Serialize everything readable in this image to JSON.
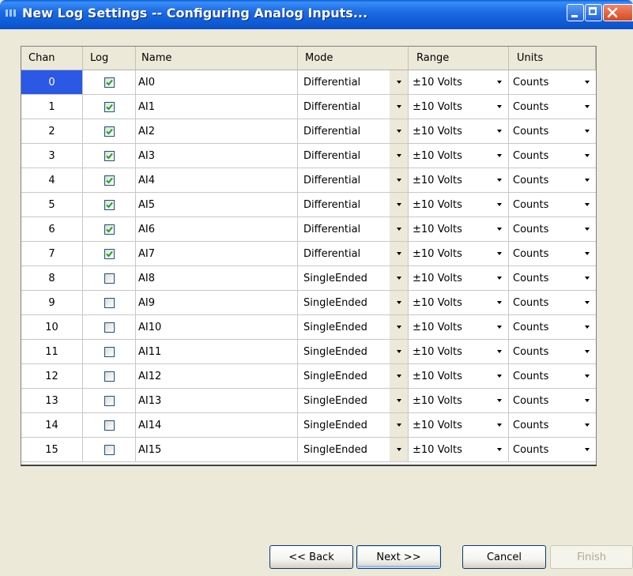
{
  "window": {
    "title": "New Log Settings -- Configuring Analog Inputs...",
    "icons": [
      "app-icon",
      "minimize-icon",
      "maximize-icon",
      "close-icon"
    ]
  },
  "grid": {
    "columns": [
      "Chan",
      "Log",
      "Name",
      "Mode",
      "Range",
      "Units"
    ],
    "selected_chan": "0",
    "rows": [
      {
        "chan": "0",
        "log": true,
        "name": "AI0",
        "mode": "Differential",
        "range": "±10 Volts",
        "units": "Counts"
      },
      {
        "chan": "1",
        "log": true,
        "name": "AI1",
        "mode": "Differential",
        "range": "±10 Volts",
        "units": "Counts"
      },
      {
        "chan": "2",
        "log": true,
        "name": "AI2",
        "mode": "Differential",
        "range": "±10 Volts",
        "units": "Counts"
      },
      {
        "chan": "3",
        "log": true,
        "name": "AI3",
        "mode": "Differential",
        "range": "±10 Volts",
        "units": "Counts"
      },
      {
        "chan": "4",
        "log": true,
        "name": "AI4",
        "mode": "Differential",
        "range": "±10 Volts",
        "units": "Counts"
      },
      {
        "chan": "5",
        "log": true,
        "name": "AI5",
        "mode": "Differential",
        "range": "±10 Volts",
        "units": "Counts"
      },
      {
        "chan": "6",
        "log": true,
        "name": "AI6",
        "mode": "Differential",
        "range": "±10 Volts",
        "units": "Counts"
      },
      {
        "chan": "7",
        "log": true,
        "name": "AI7",
        "mode": "Differential",
        "range": "±10 Volts",
        "units": "Counts"
      },
      {
        "chan": "8",
        "log": false,
        "name": "AI8",
        "mode": "SingleEnded",
        "range": "±10 Volts",
        "units": "Counts"
      },
      {
        "chan": "9",
        "log": false,
        "name": "AI9",
        "mode": "SingleEnded",
        "range": "±10 Volts",
        "units": "Counts"
      },
      {
        "chan": "10",
        "log": false,
        "name": "AI10",
        "mode": "SingleEnded",
        "range": "±10 Volts",
        "units": "Counts"
      },
      {
        "chan": "11",
        "log": false,
        "name": "AI11",
        "mode": "SingleEnded",
        "range": "±10 Volts",
        "units": "Counts"
      },
      {
        "chan": "12",
        "log": false,
        "name": "AI12",
        "mode": "SingleEnded",
        "range": "±10 Volts",
        "units": "Counts"
      },
      {
        "chan": "13",
        "log": false,
        "name": "AI13",
        "mode": "SingleEnded",
        "range": "±10 Volts",
        "units": "Counts"
      },
      {
        "chan": "14",
        "log": false,
        "name": "AI14",
        "mode": "SingleEnded",
        "range": "±10 Volts",
        "units": "Counts"
      },
      {
        "chan": "15",
        "log": false,
        "name": "AI15",
        "mode": "SingleEnded",
        "range": "±10 Volts",
        "units": "Counts"
      }
    ]
  },
  "buttons": {
    "back": "<< Back",
    "next": "Next >>",
    "cancel": "Cancel",
    "finish": "Finish",
    "finish_enabled": false
  },
  "colors": {
    "titlebar": "#0c57d2",
    "selection": "#2b59e6",
    "checkmark": "#21a121",
    "dialog_bg": "#ece9d8"
  }
}
